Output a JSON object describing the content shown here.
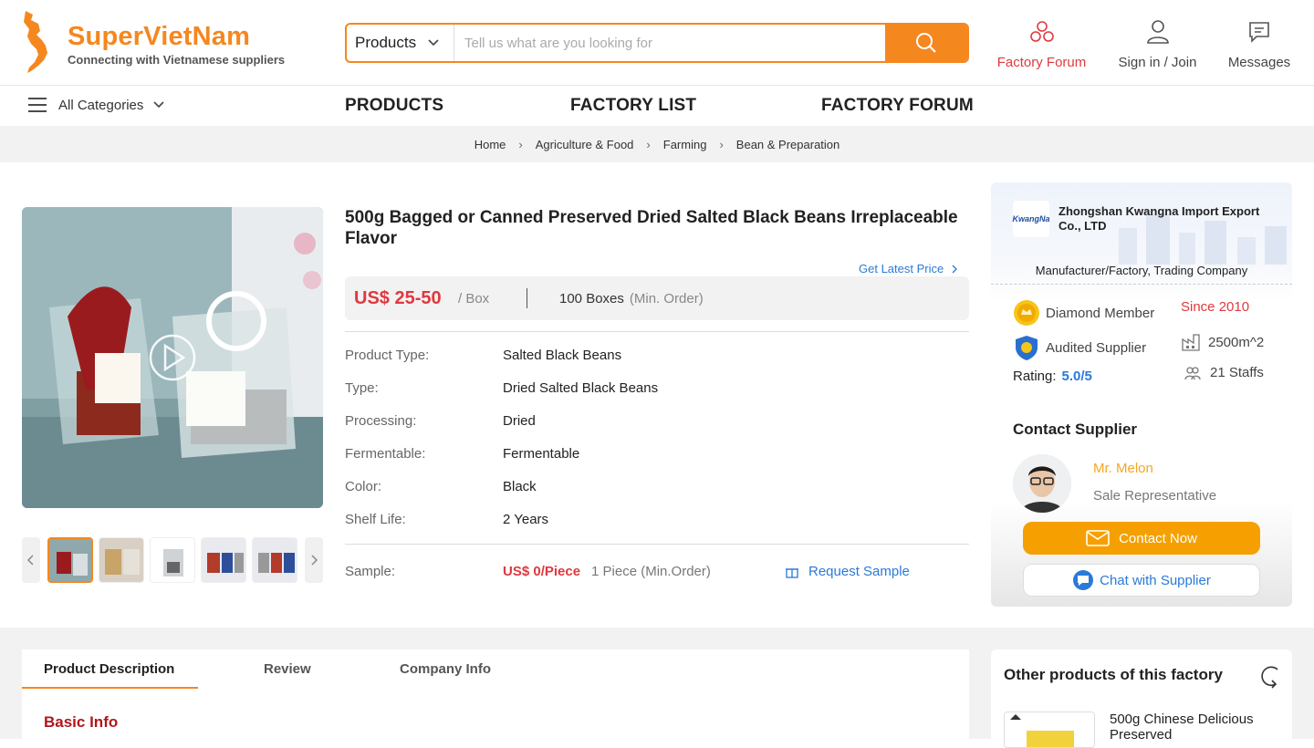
{
  "header": {
    "brand": "SuperVietNam",
    "tagline": "Connecting with Vietnamese suppliers",
    "search_category": "Products",
    "search_placeholder": "Tell us what are you looking for",
    "links": {
      "forum": "Factory Forum",
      "signin": "Sign in / Join",
      "messages": "Messages"
    },
    "accent": "#f5871f"
  },
  "nav": {
    "all_categories": "All Categories",
    "links": [
      "PRODUCTS",
      "FACTORY LIST",
      "FACTORY FORUM"
    ]
  },
  "breadcrumb": [
    "Home",
    "Agriculture & Food",
    "Farming",
    "Bean & Preparation"
  ],
  "product": {
    "title": "500g Bagged or Canned Preserved Dried Salted Black Beans Irreplaceable Flavor",
    "get_latest_price": "Get Latest Price",
    "price": "US$ 25-50",
    "unit": "/ Box",
    "moq": "100 Boxes",
    "moq_note": "(Min. Order)",
    "attributes": [
      {
        "key": "Product Type:",
        "value": "Salted Black Beans"
      },
      {
        "key": "Type:",
        "value": "Dried Salted Black Beans"
      },
      {
        "key": "Processing:",
        "value": "Dried"
      },
      {
        "key": "Fermentable:",
        "value": "Fermentable"
      },
      {
        "key": "Color:",
        "value": "Black"
      },
      {
        "key": "Shelf Life:",
        "value": "2 Years"
      }
    ],
    "sample_label": "Sample:",
    "sample_price": "US$ 0/Piece",
    "sample_min": "1 Piece (Min.Order)",
    "request_sample": "Request Sample",
    "price_color": "#e0383e"
  },
  "supplier": {
    "logo_text": "KwangNa",
    "name": "Zhongshan Kwangna Import Export Co., LTD",
    "type": "Manufacturer/Factory, Trading Company",
    "member": "Diamond Member",
    "audited": "Audited Supplier",
    "since": "Since 2010",
    "area": "2500m^2",
    "staff": "21 Staffs",
    "rating_label": "Rating:",
    "rating_value": "5.0/5",
    "contact_heading": "Contact Supplier",
    "rep_name": "Mr. Melon",
    "rep_role": "Sale Representative",
    "contact_now": "Contact Now",
    "chat": "Chat with Supplier"
  },
  "tabs": [
    "Product Description",
    "Review",
    "Company Info"
  ],
  "basic_info": "Basic Info",
  "other": {
    "heading": "Other products of this factory",
    "item_title": "500g Chinese Delicious Preserved"
  }
}
